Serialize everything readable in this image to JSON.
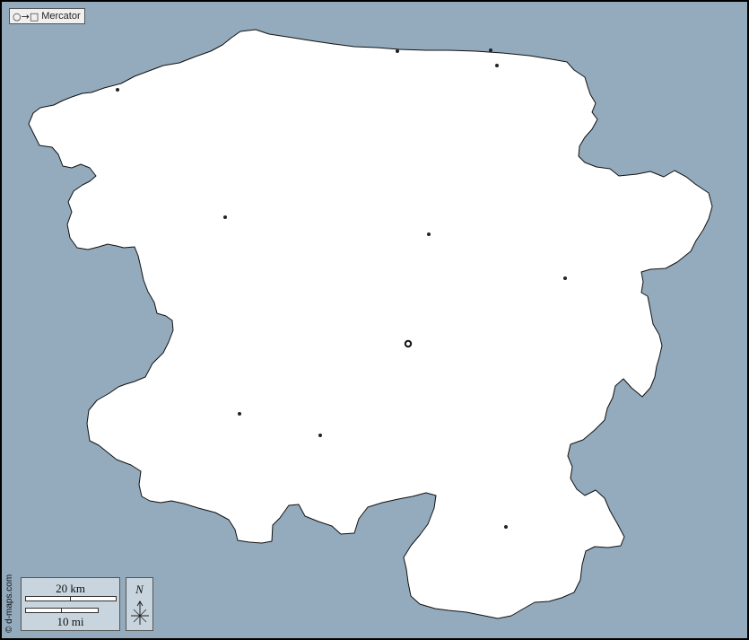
{
  "map": {
    "colors": {
      "water": "#93abbd",
      "land": "#ffffff",
      "outline": "#111111",
      "frame": "#000000"
    },
    "projection_label": "Mercator",
    "projection_icon": "circle-to-square-icon",
    "scale": {
      "km_label": "20 km",
      "mi_label": "10 mi"
    },
    "north_label": "N",
    "credit": "© d-maps.com",
    "markers": [
      {
        "kind": "town"
      },
      {
        "kind": "town"
      },
      {
        "kind": "town"
      },
      {
        "kind": "town"
      },
      {
        "kind": "town"
      },
      {
        "kind": "town"
      },
      {
        "kind": "town"
      },
      {
        "kind": "town"
      },
      {
        "kind": "town"
      },
      {
        "kind": "town"
      },
      {
        "kind": "capital"
      }
    ]
  }
}
